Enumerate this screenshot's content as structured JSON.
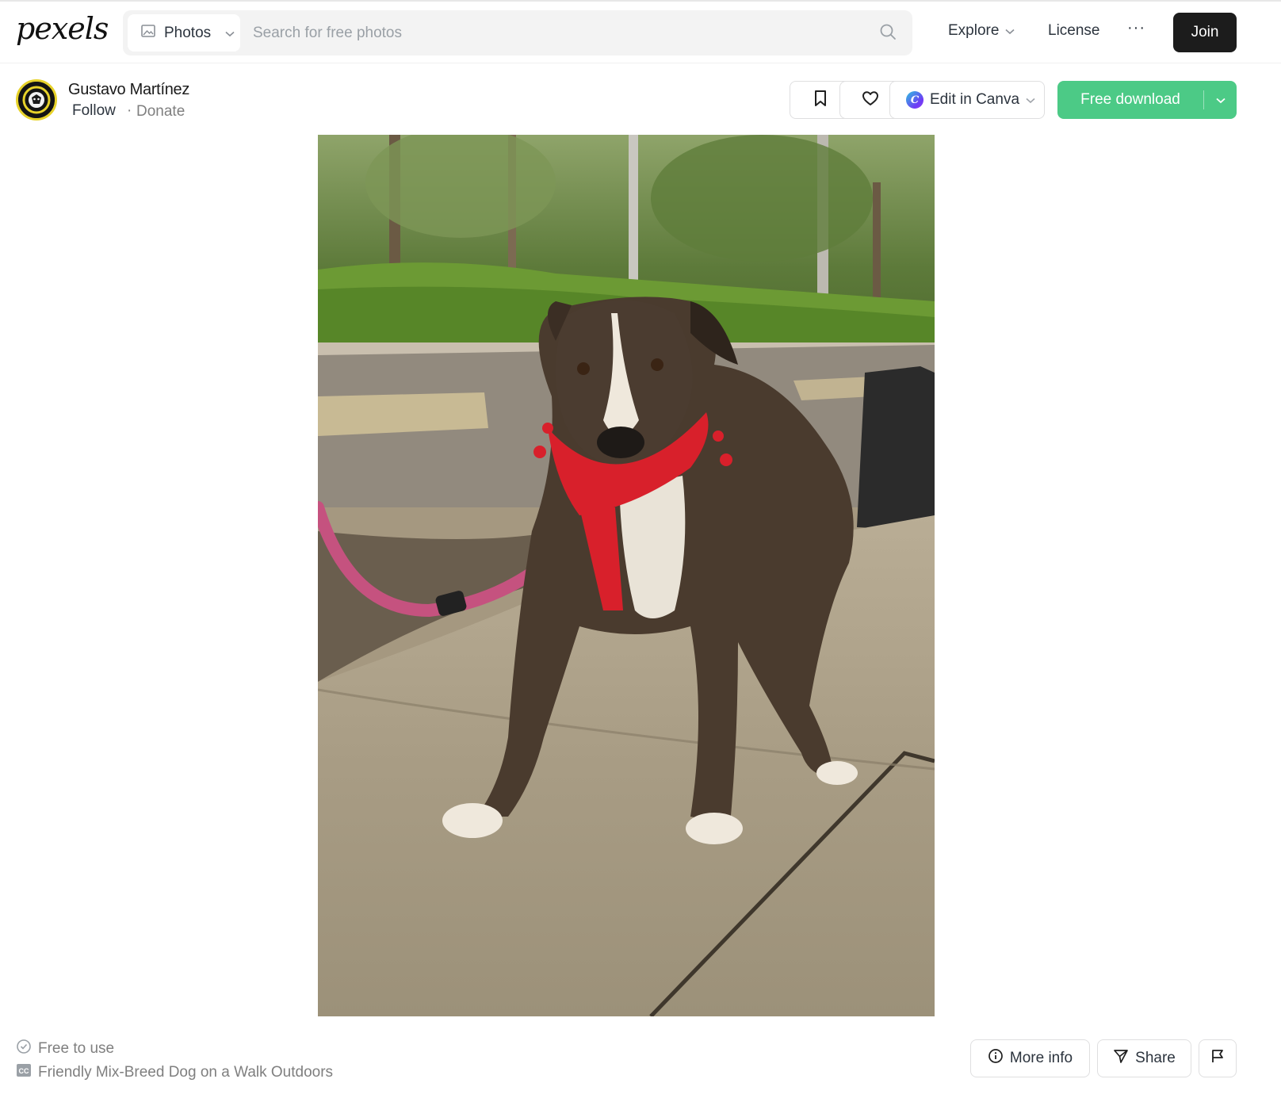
{
  "header": {
    "logo_text": "pexels",
    "search_type": {
      "label": "Photos",
      "icon": "image-icon"
    },
    "search": {
      "placeholder": "Search for free photos",
      "value": ""
    },
    "nav": {
      "explore_label": "Explore",
      "license_label": "License",
      "more_label": "···",
      "join_label": "Join"
    }
  },
  "photographer": {
    "name": "Gustavo Martínez",
    "follow_label": "Follow",
    "separator": "·",
    "donate_label": "Donate"
  },
  "actions": {
    "canva_label": "Edit in Canva",
    "download_label": "Free download"
  },
  "footer": {
    "license_text": "Free to use",
    "photo_title": "Friendly Mix-Breed Dog on a Walk Outdoors",
    "more_info_label": "More info",
    "share_label": "Share"
  },
  "colors": {
    "accent_green": "#4cca86",
    "join_black": "#1c1c1c",
    "text_dark": "#2c343e",
    "text_muted": "#7f7f7f"
  }
}
